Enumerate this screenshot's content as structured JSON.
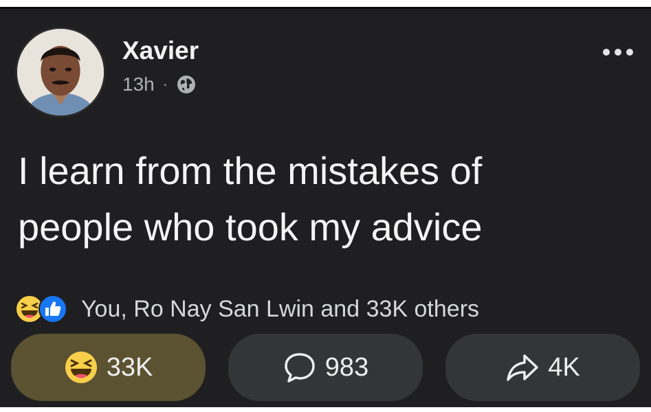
{
  "post": {
    "author": "Xavier",
    "time": "13h",
    "separator": "·",
    "privacy_icon": "globe-icon",
    "text_lines": [
      "I learn from the mistakes of",
      "people who took my advice"
    ]
  },
  "reactions": {
    "icons": [
      "haha-icon",
      "like-icon"
    ],
    "summary": "You, Ro Nay San Lwin and 33K others"
  },
  "actions": {
    "react_count": "33K",
    "comment_count": "983",
    "share_count": "4K"
  },
  "colors": {
    "background": "#1f1f21",
    "react_button_active": "#5b5232",
    "button": "#343538",
    "haha_yellow": "#f7cf4a",
    "like_blue": "#1877f2"
  }
}
